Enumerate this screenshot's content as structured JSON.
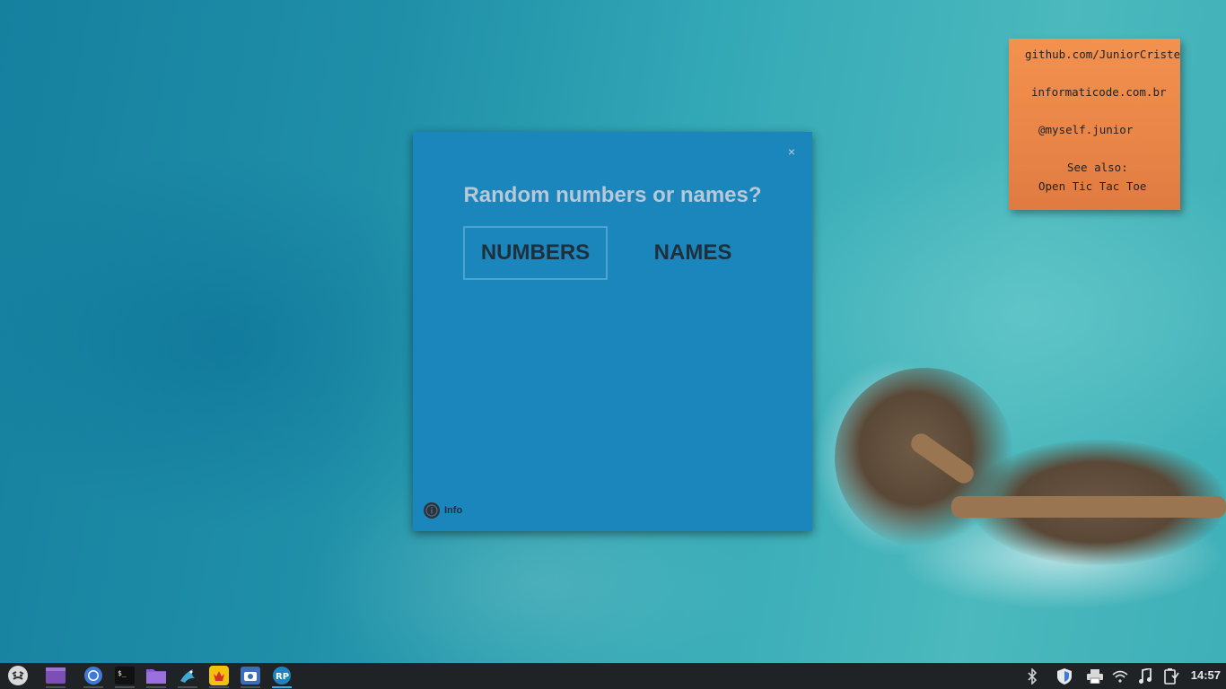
{
  "sticky_note": {
    "line1": "github.com/JuniorCriste",
    "line2": "informaticode.com.br",
    "line3": "@myself.junior",
    "line4": "See also:",
    "line5": "Open Tic Tac Toe"
  },
  "window": {
    "close_label": "×",
    "title": "Random numbers or names?",
    "numbers_label": "NUMBERS",
    "names_label": "NAMES",
    "info_label": "Info"
  },
  "taskbar": {
    "apps": [
      "menu-icon",
      "window-icon",
      "chromium-icon",
      "terminal-icon",
      "folder-icon",
      "gecko-icon",
      "yellow-app-icon",
      "screenshot-icon",
      "random-picker-icon"
    ],
    "tray": [
      "bluetooth-icon",
      "shield-icon",
      "printer-icon",
      "wifi-icon",
      "music-icon",
      "battery-icon"
    ],
    "clock": "14:57"
  },
  "colors": {
    "window_bg": "#1a86bb",
    "sticky_bg": "#e98547",
    "taskbar_bg": "#202326",
    "active_indicator": "#2eb0e0"
  }
}
